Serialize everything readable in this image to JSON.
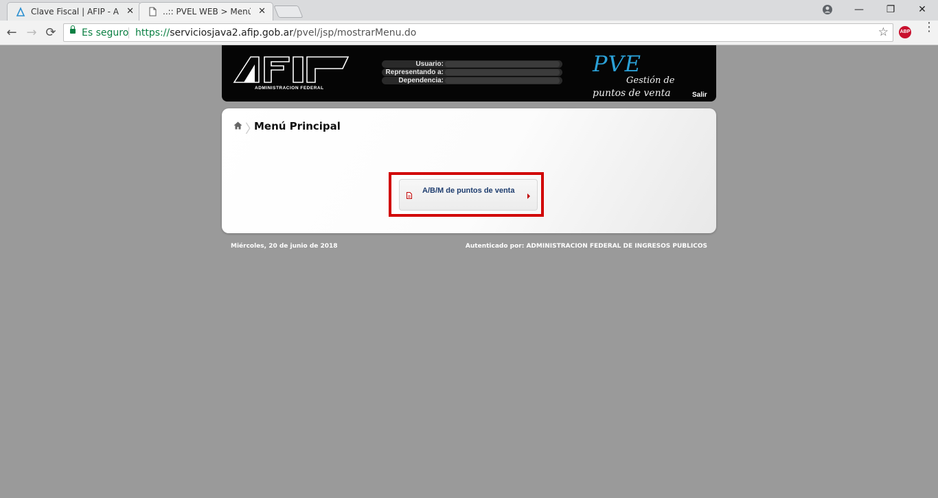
{
  "browser": {
    "tabs": [
      {
        "title": "Clave Fiscal | AFIP - Admi",
        "close": "✕",
        "icon": "afip-favicon-icon"
      },
      {
        "title": "..:: PVEL WEB > Menú Prin",
        "close": "✕",
        "icon": "page-icon"
      }
    ],
    "window": {
      "minimize": "—",
      "restore": "❐",
      "close": "✕"
    },
    "nav": {
      "back": "←",
      "forward": "→",
      "reload": "⟳"
    },
    "address": {
      "secure_label": "Es seguro",
      "protocol": "https://",
      "host": "serviciosjava2.afip.gob.ar",
      "path": "/pvel/jsp/mostrarMenu.do"
    },
    "bookmark_star": "☆",
    "extension_label": "ABP",
    "menu": "⋮",
    "colors": {
      "secure": "#0b8043"
    }
  },
  "header": {
    "logo_text": "AFIP",
    "logo_subtitle": "ADMINISTRACION FEDERAL",
    "fields": [
      {
        "label": "Usuario:",
        "value": ""
      },
      {
        "label": "Representando a:",
        "value": ""
      },
      {
        "label": "Dependencia:",
        "value": ""
      }
    ],
    "app_name": "PVE",
    "app_subtitle_1": "Gestión de",
    "app_subtitle_2": "puntos de venta",
    "logout": "Salir",
    "colors": {
      "background": "#050505",
      "app_name": "#2aa0d6"
    }
  },
  "main": {
    "breadcrumb_home_icon": "home-icon",
    "title": "Menú Principal",
    "menu_items": [
      {
        "label": "A/B/M de puntos de venta",
        "icon": "document-icon",
        "highlighted": true
      }
    ],
    "colors": {
      "highlight_border": "#d10000",
      "link": "#1d3c6e"
    }
  },
  "footer": {
    "date": "Miércoles, 20 de junio de 2018",
    "auth_prefix": "Autenticado por:",
    "auth_org": "ADMINISTRACION FEDERAL DE INGRESOS PUBLICOS"
  }
}
